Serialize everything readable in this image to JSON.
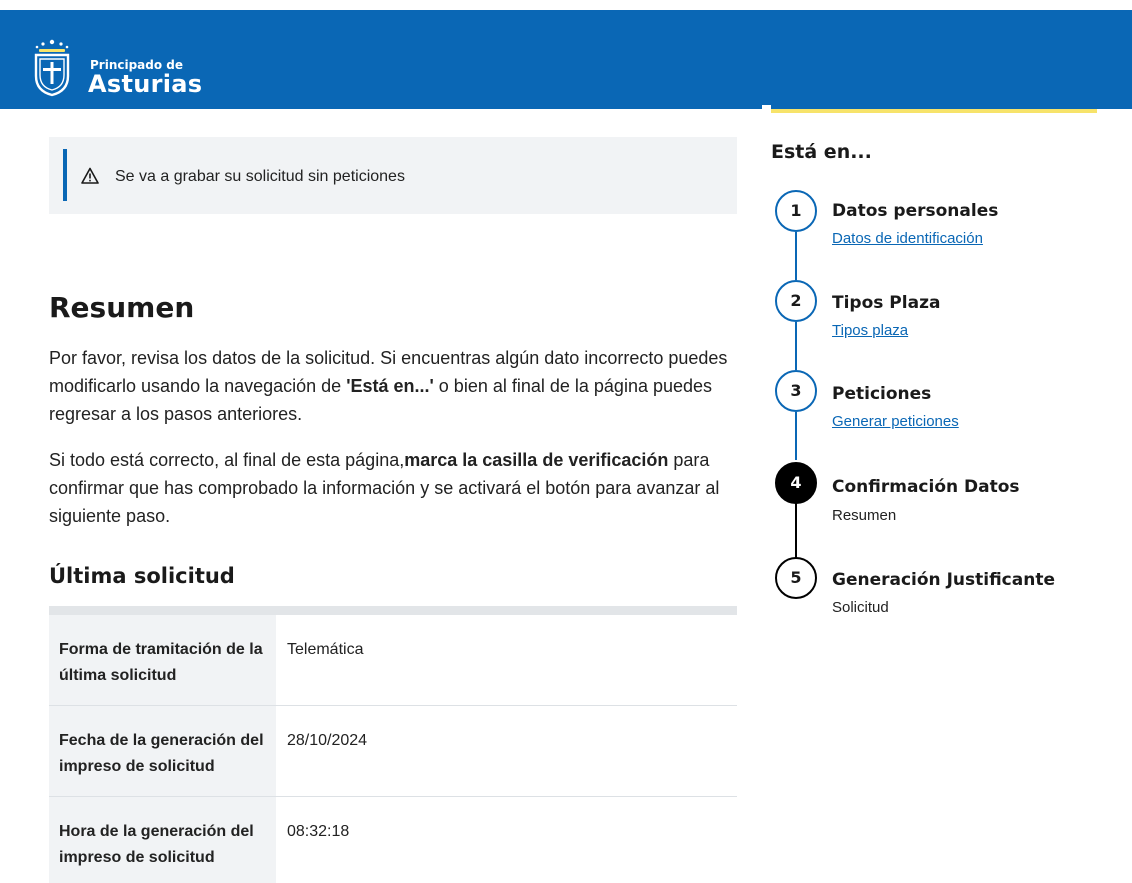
{
  "header": {
    "logo_small": "Principado de",
    "logo_big": "Asturias"
  },
  "alert": {
    "text": "Se va a grabar su solicitud sin peticiones",
    "icon": "warning-triangle-icon"
  },
  "main": {
    "title": "Resumen",
    "para1_a": "Por favor, revisa los datos de la solicitud. Si encuentras algún dato incorrecto puedes modificarlo usando la navegación de ",
    "para1_b": "'Está en...'",
    "para1_c": " o bien al final de la página puedes regresar a los pasos anteriores.",
    "para2_a": "Si todo está correcto, al final de esta página,",
    "para2_b": "marca la casilla de verificación",
    "para2_c": " para confirmar que has comprobado la información y se activará el botón para avanzar al siguiente paso.",
    "subtitle": "Última solicitud",
    "rows": [
      {
        "label": "Forma de tramitación de la última solicitud",
        "value": "Telemática"
      },
      {
        "label": "Fecha de la generación del impreso de solicitud",
        "value": "28/10/2024"
      },
      {
        "label": "Hora de la generación del impreso de solicitud",
        "value": "08:32:18"
      }
    ]
  },
  "sidebar": {
    "title": "Está en...",
    "steps": [
      {
        "number": "1",
        "title": "Datos personales",
        "sub": "Datos de identificación",
        "state": "done"
      },
      {
        "number": "2",
        "title": "Tipos Plaza",
        "sub": "Tipos plaza",
        "state": "done"
      },
      {
        "number": "3",
        "title": "Peticiones",
        "sub": "Generar peticiones",
        "state": "done"
      },
      {
        "number": "4",
        "title": "Confirmación Datos",
        "sub": "Resumen",
        "state": "active"
      },
      {
        "number": "5",
        "title": "Generación Justificante",
        "sub": "Solicitud",
        "state": "pending"
      }
    ]
  },
  "colors": {
    "brand_blue": "#0a67b5",
    "accent_yellow": "#f7e36a",
    "panel_grey": "#f1f3f5"
  }
}
